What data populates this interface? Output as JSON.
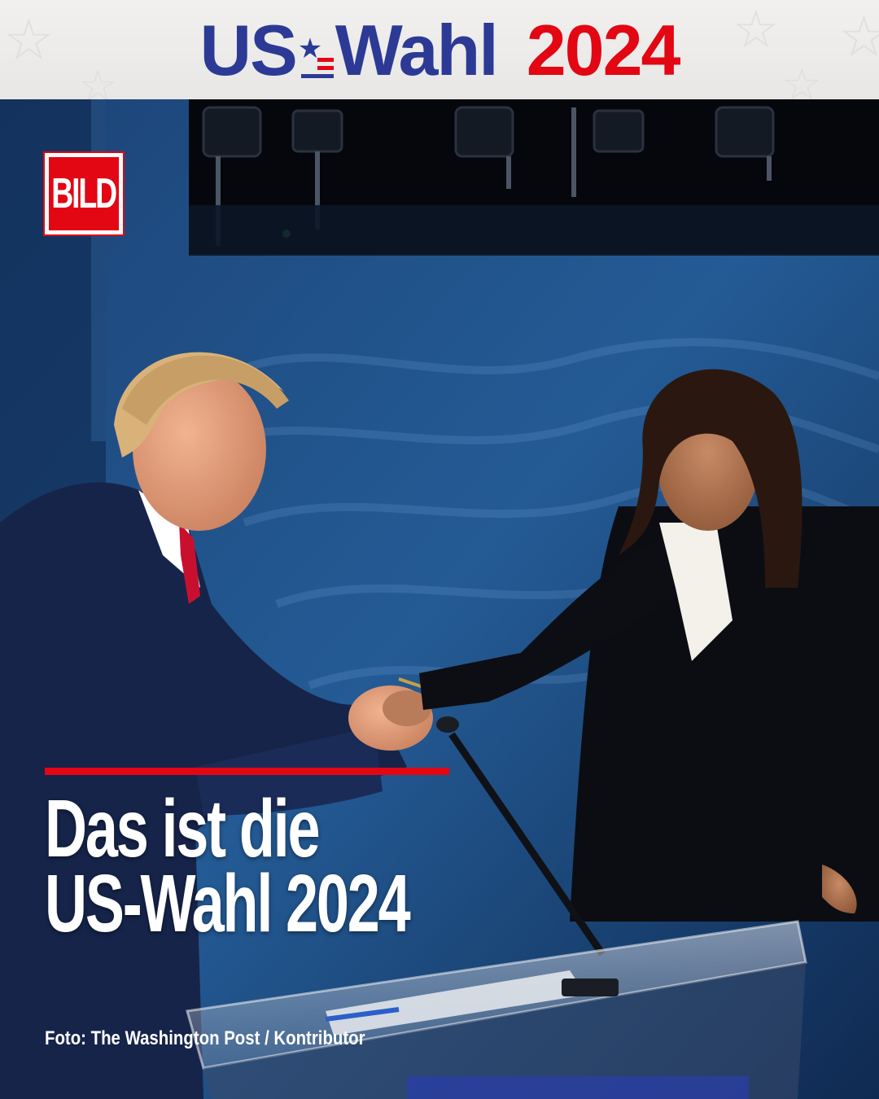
{
  "header": {
    "title_us": "US",
    "title_wahl": "Wahl",
    "title_year": "2024",
    "flag_icon": "star-stripes-icon",
    "colors": {
      "blue": "#2c3a96",
      "red": "#e30613",
      "background": "#efeeec"
    }
  },
  "logo": {
    "text": "BILD",
    "color": "#e30613"
  },
  "headline": {
    "line1": "Das ist die",
    "line2": "US-Wahl 2024",
    "rule_color": "#e30613"
  },
  "credit": {
    "text": "Foto: The Washington Post / Kontributor"
  },
  "photo": {
    "description_icon": "debate-handshake-photo"
  }
}
